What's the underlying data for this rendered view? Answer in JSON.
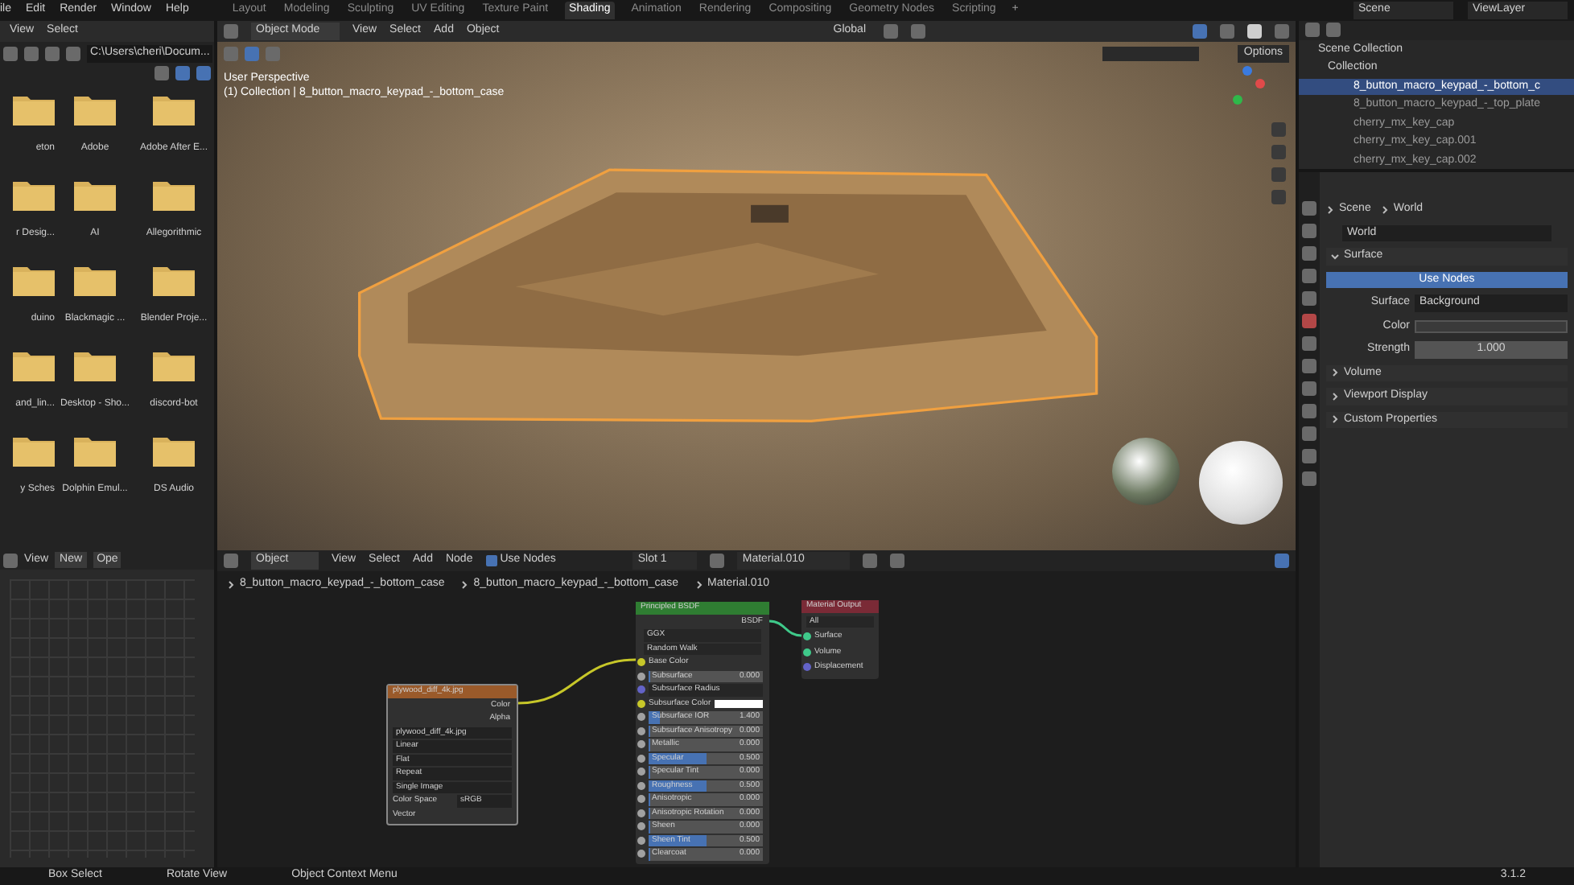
{
  "top_menu": [
    "ile",
    "Edit",
    "Render",
    "Window",
    "Help"
  ],
  "workspaces": [
    {
      "label": "Layout",
      "selected": false
    },
    {
      "label": "Modeling",
      "selected": false
    },
    {
      "label": "Sculpting",
      "selected": false
    },
    {
      "label": "UV Editing",
      "selected": false
    },
    {
      "label": "Texture Paint",
      "selected": false
    },
    {
      "label": "Shading",
      "selected": true
    },
    {
      "label": "Animation",
      "selected": false
    },
    {
      "label": "Rendering",
      "selected": false
    },
    {
      "label": "Compositing",
      "selected": false
    },
    {
      "label": "Geometry Nodes",
      "selected": false
    },
    {
      "label": "Scripting",
      "selected": false
    }
  ],
  "add_workspace": "+",
  "scene": "Scene",
  "view_layer": "ViewLayer",
  "file_browser": {
    "menu": [
      "View",
      "Select"
    ],
    "path": "C:\\Users\\cheri\\Docum...",
    "folders": [
      "eton",
      "Adobe",
      "Adobe After E...",
      "r Desig...",
      "AI",
      "Allegorithmic",
      "duino",
      "Blackmagic ...",
      "Blender Proje...",
      "and_lin...",
      "Desktop - Sho...",
      "discord-bot",
      "y Sches",
      "Dolphin Emul...",
      "DS Audio"
    ]
  },
  "image_editor": {
    "menu": [
      "View"
    ],
    "new": "New",
    "open": "Ope"
  },
  "viewport": {
    "mode": "Object Mode",
    "menu": [
      "View",
      "Select",
      "Add",
      "Object"
    ],
    "orientation": "Global",
    "options": "Options",
    "perspective": "User Perspective",
    "collection_info": "(1) Collection | 8_button_macro_keypad_-_bottom_case"
  },
  "outliner": {
    "root": "Scene Collection",
    "collection": "Collection",
    "items": [
      {
        "label": "8_button_macro_keypad_-_bottom_c",
        "selected": true
      },
      {
        "label": "8_button_macro_keypad_-_top_plate",
        "selected": false
      },
      {
        "label": "cherry_mx_key_cap",
        "selected": false
      },
      {
        "label": "cherry_mx_key_cap.001",
        "selected": false
      },
      {
        "label": "cherry_mx_key_cap.002",
        "selected": false
      }
    ]
  },
  "properties": {
    "breadcrumb": [
      "Scene",
      "World"
    ],
    "world": "World",
    "panels": [
      {
        "label": "Surface",
        "expanded": true
      },
      {
        "label": "Volume",
        "expanded": false
      },
      {
        "label": "Viewport Display",
        "expanded": false
      },
      {
        "label": "Custom Properties",
        "expanded": false
      }
    ],
    "use_nodes": "Use Nodes",
    "surface_label": "Surface",
    "surface_value": "Background",
    "color_label": "Color",
    "strength_label": "Strength",
    "strength_value": "1.000"
  },
  "node_editor": {
    "mode": "Object",
    "menu": [
      "View",
      "Select",
      "Add",
      "Node"
    ],
    "use_nodes": {
      "label": "Use Nodes",
      "checked": true
    },
    "slot": "Slot 1",
    "material": "Material.010",
    "breadcrumb": [
      "8_button_macro_keypad_-_bottom_case",
      "8_button_macro_keypad_-_bottom_case",
      "Material.010"
    ],
    "image_node": {
      "title": "plywood_diff_4k.jpg",
      "outputs": [
        "Color",
        "Alpha"
      ],
      "image": "plywood_diff_4k.jpg",
      "options": [
        "Linear",
        "Flat",
        "Repeat",
        "Single Image"
      ],
      "color_space_label": "Color Space",
      "color_space": "sRGB",
      "vector": "Vector"
    },
    "bsdf_node": {
      "title": "Principled BSDF",
      "output": "BSDF",
      "dropdowns": [
        "GGX",
        "Random Walk"
      ],
      "inputs": [
        {
          "kind": "socket",
          "label": "Base Color"
        },
        {
          "kind": "slider",
          "label": "Subsurface",
          "value": "0.000",
          "level": 0
        },
        {
          "kind": "dropdown",
          "label": "Subsurface Radius"
        },
        {
          "kind": "color",
          "label": "Subsurface Color"
        },
        {
          "kind": "slider",
          "label": "Subsurface IOR",
          "value": "1.400",
          "level": 0.1
        },
        {
          "kind": "slider",
          "label": "Subsurface Anisotropy",
          "value": "0.000",
          "level": 0
        },
        {
          "kind": "slider",
          "label": "Metallic",
          "value": "0.000",
          "level": 0
        },
        {
          "kind": "slider",
          "label": "Specular",
          "value": "0.500",
          "level": 0.5
        },
        {
          "kind": "slider",
          "label": "Specular Tint",
          "value": "0.000",
          "level": 0
        },
        {
          "kind": "slider",
          "label": "Roughness",
          "value": "0.500",
          "level": 0.5
        },
        {
          "kind": "slider",
          "label": "Anisotropic",
          "value": "0.000",
          "level": 0
        },
        {
          "kind": "slider",
          "label": "Anisotropic Rotation",
          "value": "0.000",
          "level": 0
        },
        {
          "kind": "slider",
          "label": "Sheen",
          "value": "0.000",
          "level": 0
        },
        {
          "kind": "slider",
          "label": "Sheen Tint",
          "value": "0.500",
          "level": 0.5
        },
        {
          "kind": "slider",
          "label": "Clearcoat",
          "value": "0.000",
          "level": 0
        }
      ]
    },
    "output_node": {
      "title": "Material Output",
      "target": "All",
      "inputs": [
        "Surface",
        "Volume",
        "Displacement"
      ]
    }
  },
  "status_bar": {
    "items": [
      "Box Select",
      "Rotate View",
      "Object Context Menu"
    ],
    "version": "3.1.2"
  }
}
